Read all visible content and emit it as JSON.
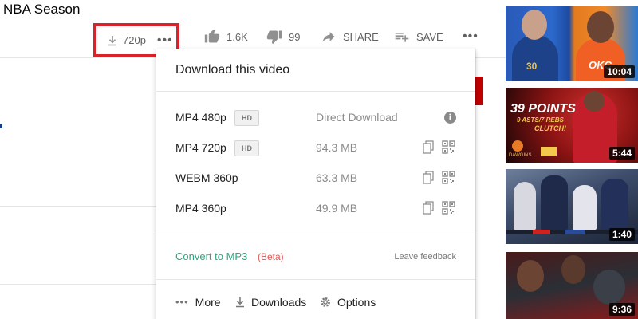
{
  "video": {
    "title": "NBA Season"
  },
  "toolbar": {
    "download_quality": "720p",
    "more_label": "•••",
    "like_count": "1.6K",
    "dislike_count": "99",
    "share_label": "SHARE",
    "save_label": "SAVE",
    "overflow_label": "•••"
  },
  "download_popup": {
    "title": "Download this video",
    "formats": [
      {
        "format": "MP4 480p",
        "badge": "HD",
        "size": "Direct Download",
        "action": "info-icon"
      },
      {
        "format": "MP4 720p",
        "badge": "HD",
        "size": "94.3 MB",
        "action": "copy-icon qr-icon"
      },
      {
        "format": "WEBM 360p",
        "badge": "",
        "size": "63.3 MB",
        "action": "copy-icon qr-icon"
      },
      {
        "format": "MP4 360p",
        "badge": "",
        "size": "49.9 MB",
        "action": "copy-icon qr-icon"
      }
    ],
    "info_glyph": "i",
    "convert_label": "Convert to MP3",
    "beta_label": "(Beta)",
    "feedback_label": "Leave feedback",
    "footer": {
      "more_dots": "•••",
      "more_label": "More",
      "downloads_label": "Downloads",
      "options_label": "Options"
    }
  },
  "thumbnails": [
    {
      "duration": "10:04",
      "overlay": "OKC",
      "number": "30"
    },
    {
      "duration": "5:44",
      "headline": "39 POINTS",
      "subline": "9 ASTS/7 REBS",
      "tag": "CLUTCH!",
      "brand": "DAWGINS"
    },
    {
      "duration": "1:40"
    },
    {
      "duration": "9:36"
    }
  ],
  "colors": {
    "highlight_border": "#d9222a",
    "convert_link": "#2ea680",
    "beta": "#e05757",
    "duration_badge_bg": "#000000"
  }
}
